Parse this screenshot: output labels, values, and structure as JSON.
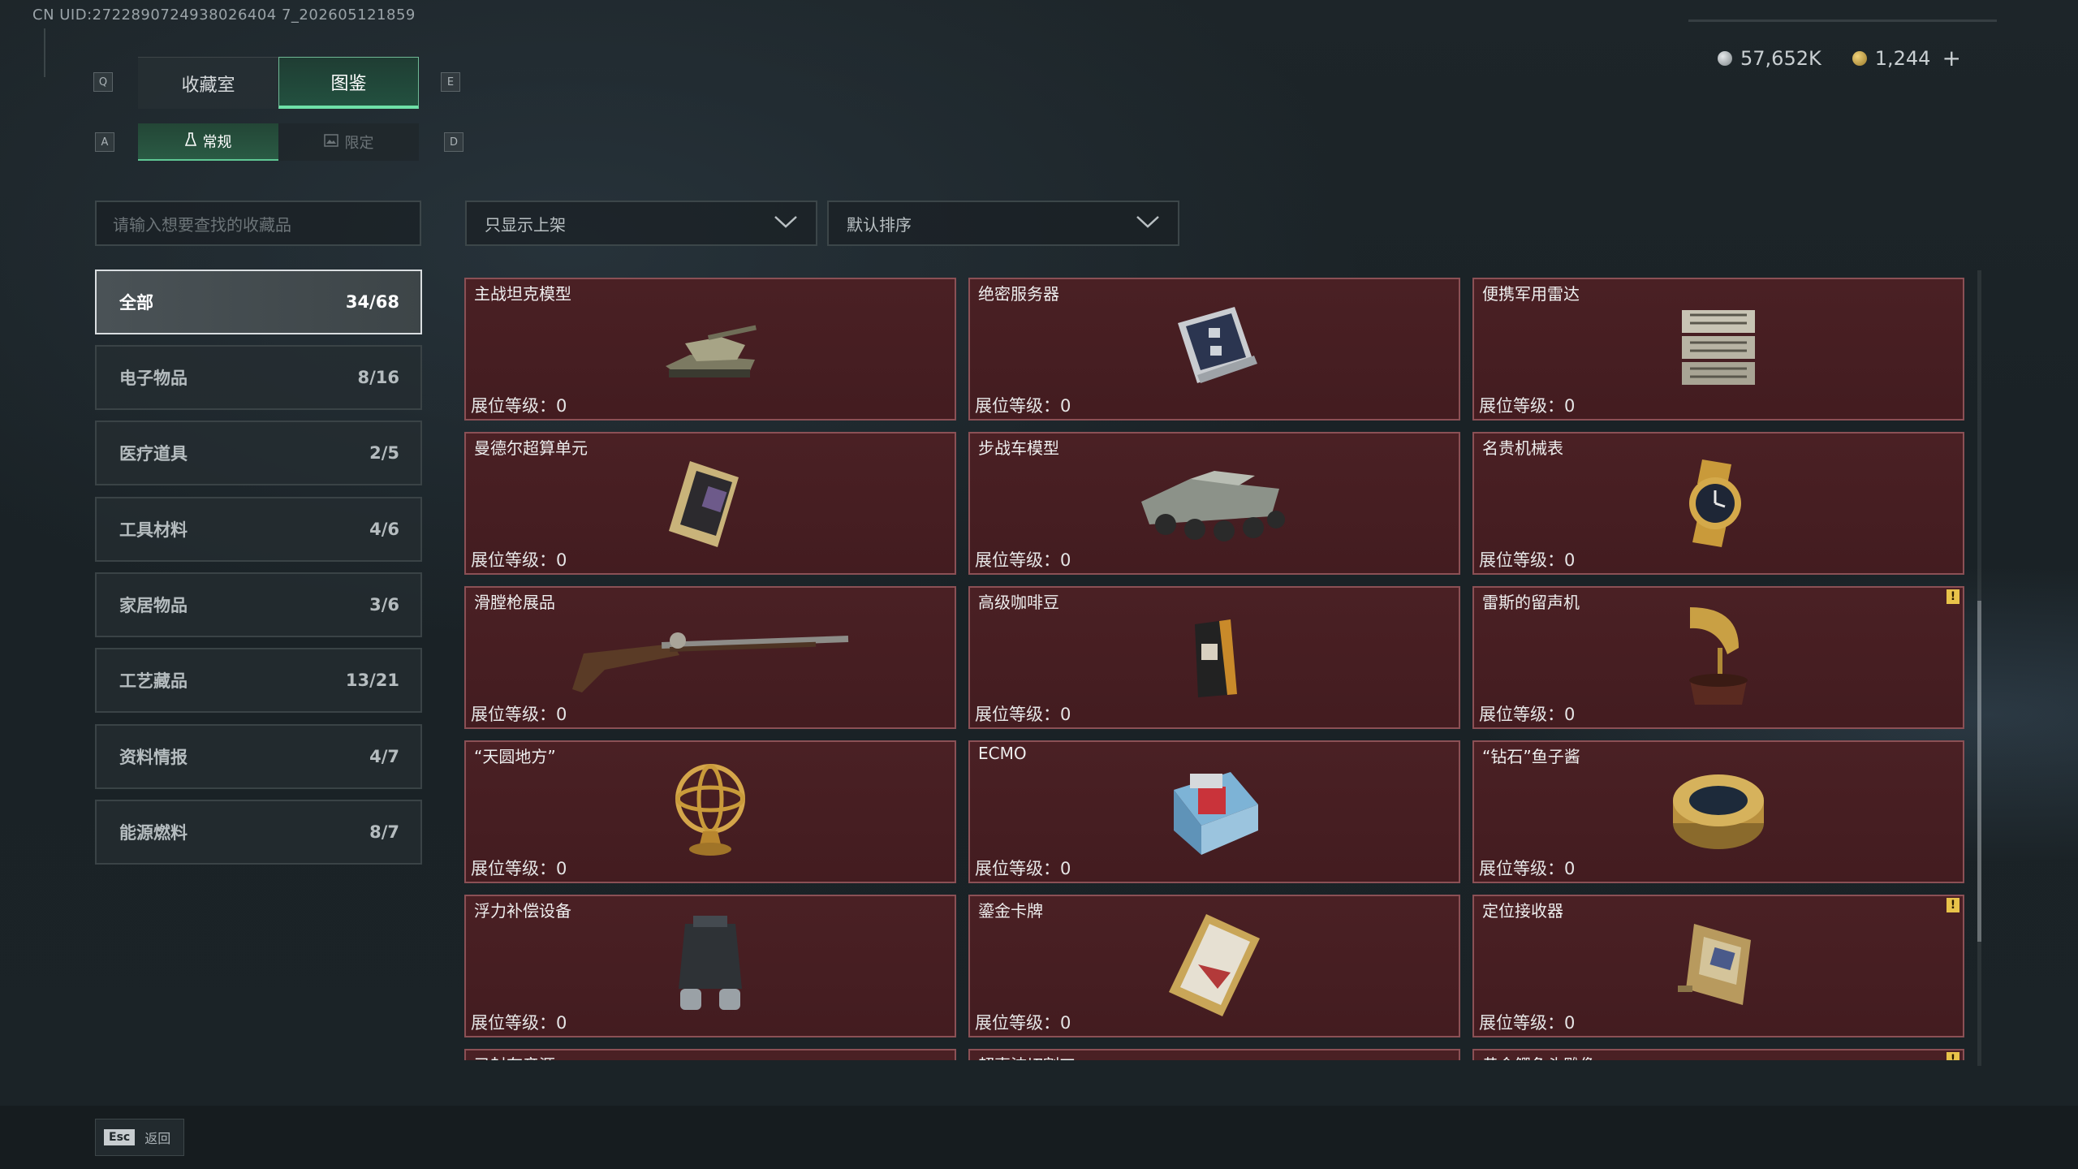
{
  "uid_text": "CN UID:2722890724938026404 7_202605121859",
  "top_tabs": {
    "key_left": "Q",
    "key_right": "E",
    "collection": "收藏室",
    "catalog": "图鉴"
  },
  "sub_tabs": {
    "key_left": "A",
    "key_right": "D",
    "normal": "常规",
    "limited": "限定"
  },
  "currency": {
    "silver": "57,652K",
    "gold": "1,244",
    "add": "+"
  },
  "search": {
    "placeholder": "请输入想要查找的收藏品"
  },
  "filters": {
    "display": "只显示上架",
    "sort": "默认排序"
  },
  "categories": [
    {
      "label": "全部",
      "count": "34/68"
    },
    {
      "label": "电子物品",
      "count": "8/16"
    },
    {
      "label": "医疗道具",
      "count": "2/5"
    },
    {
      "label": "工具材料",
      "count": "4/6"
    },
    {
      "label": "家居物品",
      "count": "3/6"
    },
    {
      "label": "工艺藏品",
      "count": "13/21"
    },
    {
      "label": "资料情报",
      "count": "4/7"
    },
    {
      "label": "能源燃料",
      "count": "8/7"
    }
  ],
  "level_label": "展位等级：0",
  "items": [
    {
      "name": "主战坦克模型",
      "icon": "tank-model-icon"
    },
    {
      "name": "绝密服务器",
      "icon": "server-icon"
    },
    {
      "name": "便携军用雷达",
      "icon": "radar-icon"
    },
    {
      "name": "曼德尔超算单元",
      "icon": "compute-unit-icon"
    },
    {
      "name": "步战车模型",
      "icon": "ifv-model-icon"
    },
    {
      "name": "名贵机械表",
      "icon": "watch-icon"
    },
    {
      "name": "滑膛枪展品",
      "icon": "musket-icon"
    },
    {
      "name": "高级咖啡豆",
      "icon": "coffee-bag-icon"
    },
    {
      "name": "雷斯的留声机",
      "icon": "gramophone-icon",
      "badge": "!"
    },
    {
      "name": "“天圆地方”",
      "icon": "armillary-icon"
    },
    {
      "name": "ECMO",
      "icon": "ecmo-icon"
    },
    {
      "name": "“钻石”鱼子酱",
      "icon": "caviar-icon"
    },
    {
      "name": "浮力补偿设备",
      "icon": "bcd-icon"
    },
    {
      "name": "鎏金卡牌",
      "icon": "card-icon"
    },
    {
      "name": "定位接收器",
      "icon": "receiver-icon",
      "badge": "!"
    },
    {
      "name": "已封存音源",
      "icon": "audio-icon"
    },
    {
      "name": "超声波切割刀",
      "icon": "ultrasonic-knife-icon"
    },
    {
      "name": "黄金鳄鱼头雕像",
      "icon": "croc-statue-icon",
      "badge": "!"
    }
  ],
  "footer": {
    "esc": "Esc",
    "back": "返回"
  },
  "colors": {
    "accent_green": "#6ee0a8",
    "card_bg": "#4a2024",
    "card_border": "#8b5055",
    "badge": "#e8c34a"
  }
}
